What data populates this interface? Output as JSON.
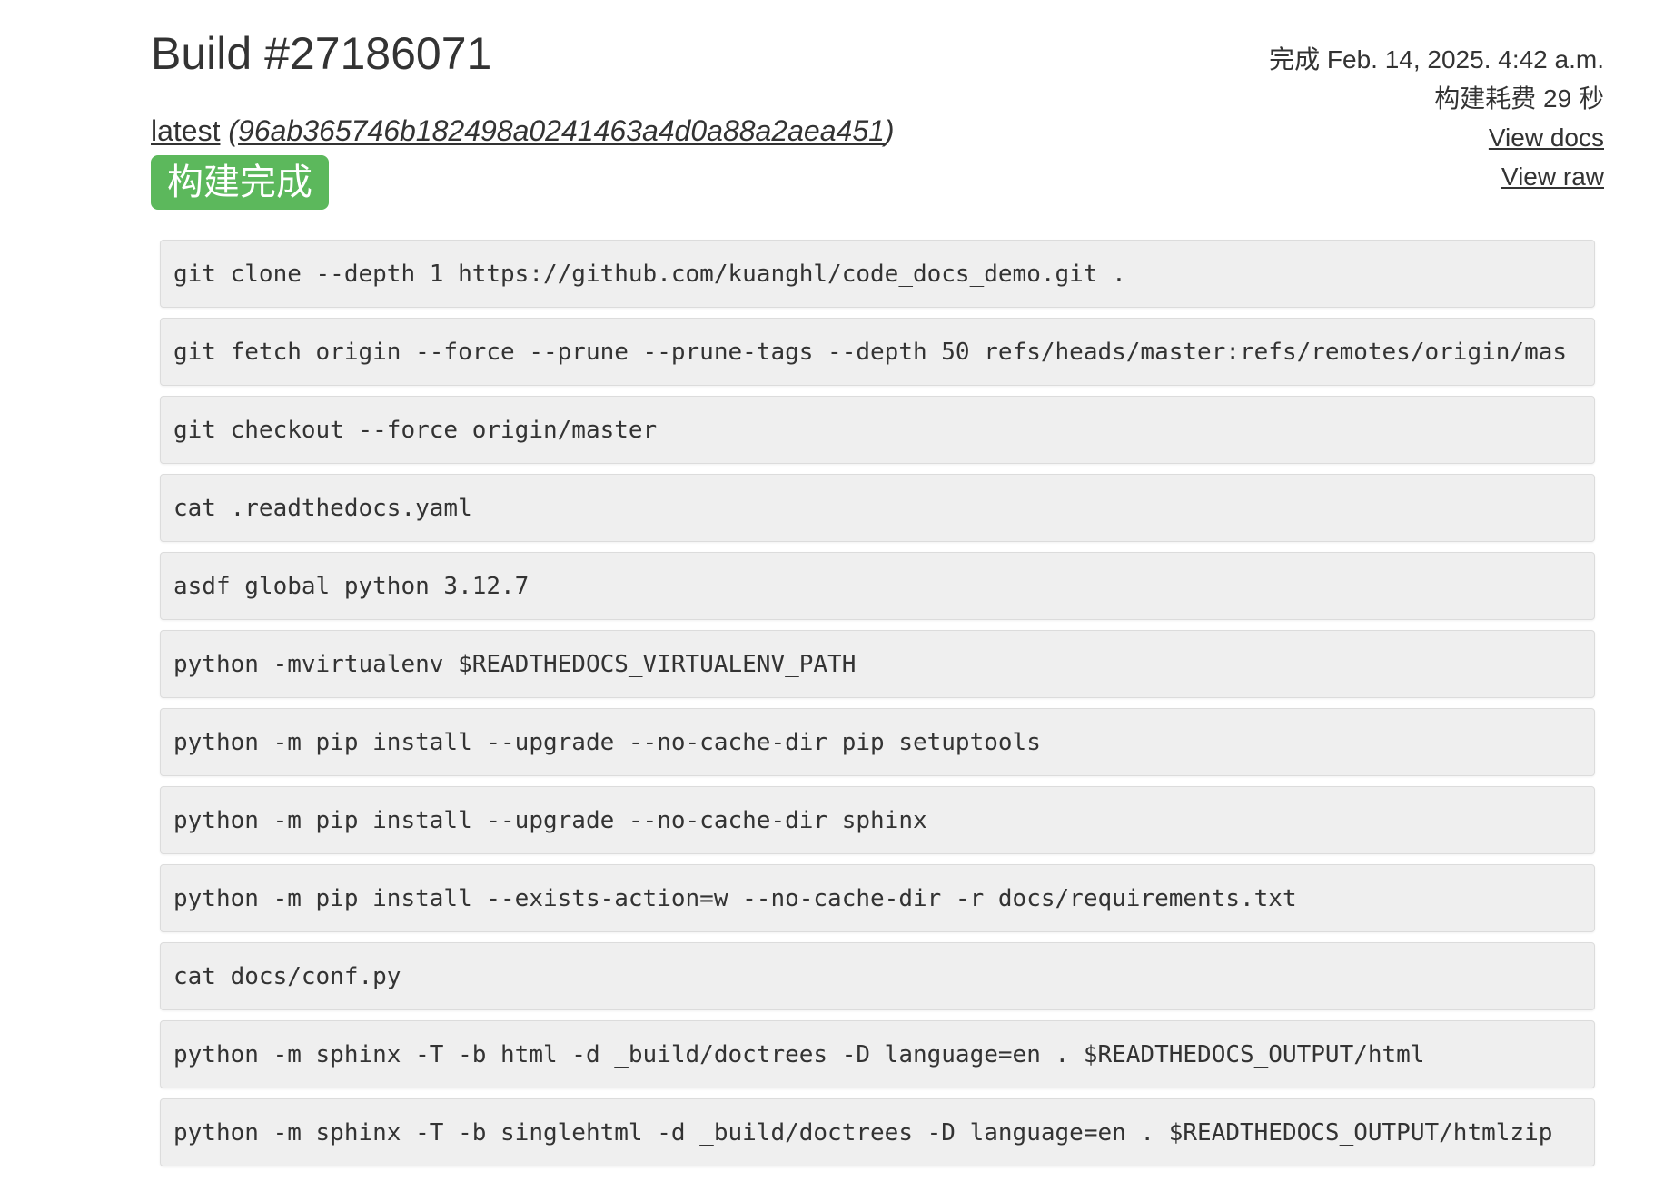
{
  "build": {
    "title": "Build #27186071",
    "version_label": "latest",
    "commit_hash": "96ab365746b182498a0241463a4d0a88a2aea451",
    "status_badge": "构建完成"
  },
  "meta": {
    "finished": "完成 Feb. 14, 2025. 4:42 a.m.",
    "duration": "构建耗费 29 秒",
    "view_docs": "View docs",
    "view_raw": "View raw"
  },
  "commands": [
    "git clone --depth 1 https://github.com/kuanghl/code_docs_demo.git .",
    "git fetch origin --force --prune --prune-tags --depth 50 refs/heads/master:refs/remotes/origin/mas",
    "git checkout --force origin/master",
    "cat .readthedocs.yaml",
    "asdf global python 3.12.7",
    "python -mvirtualenv $READTHEDOCS_VIRTUALENV_PATH",
    "python -m pip install --upgrade --no-cache-dir pip setuptools",
    "python -m pip install --upgrade --no-cache-dir sphinx",
    "python -m pip install --exists-action=w --no-cache-dir -r docs/requirements.txt",
    "cat docs/conf.py",
    "python -m sphinx -T -b html -d _build/doctrees -D language=en . $READTHEDOCS_OUTPUT/html",
    "python -m sphinx -T -b singlehtml -d _build/doctrees -D language=en . $READTHEDOCS_OUTPUT/htmlzip"
  ],
  "colors": {
    "badge_success": "#5cb85c",
    "command_background": "#efefef"
  }
}
